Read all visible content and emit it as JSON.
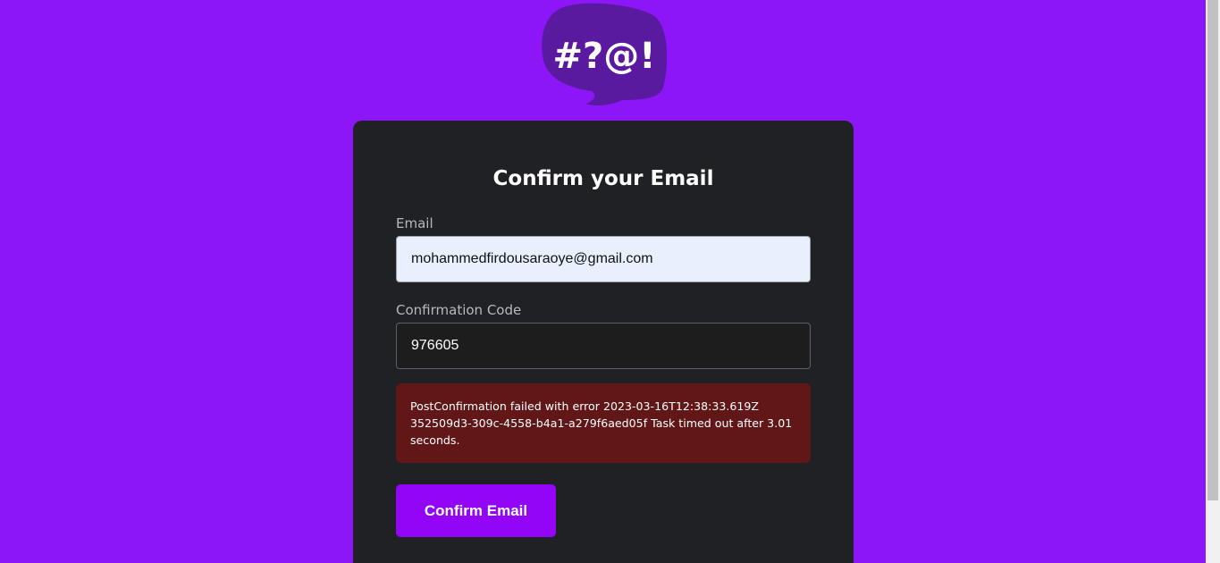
{
  "logo": {
    "text": "#?@!"
  },
  "form": {
    "title": "Confirm your Email",
    "email_label": "Email",
    "email_value": "mohammedfirdousaraoye@gmail.com",
    "code_label": "Confirmation Code",
    "code_value": "976605",
    "error_message": "PostConfirmation failed with error 2023-03-16T12:38:33.619Z 352509d3-309c-4558-b4a1-a279f6aed05f Task timed out after 3.01 seconds.",
    "submit_label": "Confirm Email"
  },
  "colors": {
    "background": "#8c16f7",
    "card": "#202124",
    "error_background": "#611717",
    "button": "#9305f7"
  }
}
